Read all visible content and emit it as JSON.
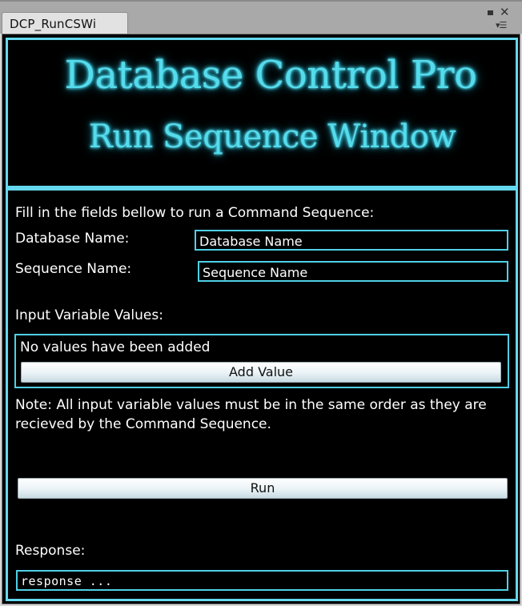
{
  "tab": {
    "title": "DCP_RunCSWi"
  },
  "window_controls": {
    "maximize_icon": "maximize-icon",
    "close_icon": "close-icon",
    "menu_icon": "menu-icon"
  },
  "banner": {
    "title": "Database Control Pro",
    "subtitle": "Run Sequence Window"
  },
  "form": {
    "instruction": "Fill in the fields bellow to run a Command Sequence:",
    "database_label": "Database Name:",
    "database_value": "Database Name",
    "sequence_label": "Sequence Name:",
    "sequence_value": "Sequence Name",
    "input_values_label": "Input Variable Values:",
    "no_values_text": "No values have been added",
    "add_value_button": "Add Value",
    "note": "Note: All input variable values must be in the same order as they are recieved by the Command Sequence.",
    "run_button": "Run",
    "response_label": "Response:",
    "response_value": "response ..."
  },
  "colors": {
    "accent": "#64d8ee",
    "background": "#000000",
    "text": "#ffffff",
    "button": "#e9f2f6"
  }
}
